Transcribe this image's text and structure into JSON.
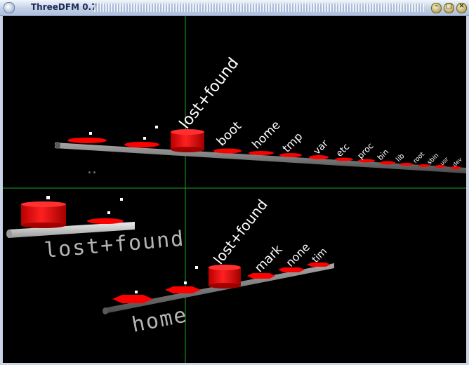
{
  "window": {
    "title": "ThreeDFM 0.7",
    "buttons": [
      "minimize",
      "maximize",
      "close"
    ]
  },
  "colors": {
    "background": "#000000",
    "crosshair": "#1f9f1f",
    "node": "#ff0000",
    "label": "#ffffff",
    "rail": "#808080"
  },
  "scene": {
    "root_dir_labels": [
      "lost+found",
      "boot",
      "home",
      "tmp",
      "var",
      "etc",
      "proc",
      "bin",
      "lib",
      "root",
      "sbin",
      "usr",
      "dev"
    ],
    "parent_marker": "..",
    "lostfound_dir": {
      "label": "lost+found"
    },
    "home_dir": {
      "label": "home",
      "child_labels": [
        "lost+found",
        "mark",
        "none",
        "tim"
      ]
    }
  }
}
